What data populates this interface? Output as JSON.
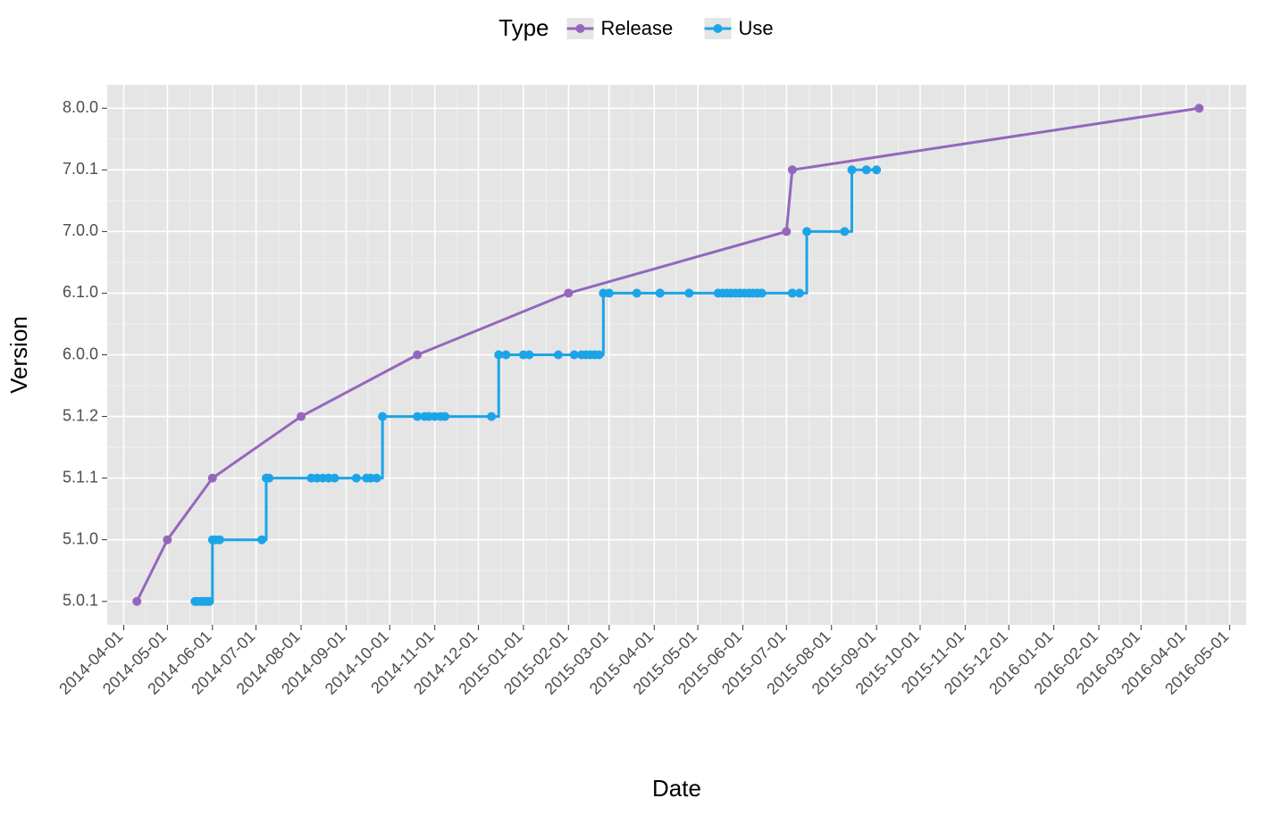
{
  "chart_data": {
    "type": "line",
    "title": "",
    "xlabel": "Date",
    "ylabel": "Version",
    "legend_title": "Type",
    "legend_position": "top",
    "colors": {
      "Release": "#9467BD",
      "Use": "#1CA4E8"
    },
    "y_categories": [
      "5.0.1",
      "5.1.0",
      "5.1.1",
      "5.1.2",
      "6.0.0",
      "6.1.0",
      "7.0.0",
      "7.0.1",
      "8.0.0"
    ],
    "x_ticks": [
      "2014-04-01",
      "2014-05-01",
      "2014-06-01",
      "2014-07-01",
      "2014-08-01",
      "2014-09-01",
      "2014-10-01",
      "2014-11-01",
      "2014-12-01",
      "2015-01-01",
      "2015-02-01",
      "2015-03-01",
      "2015-04-01",
      "2015-05-01",
      "2015-06-01",
      "2015-07-01",
      "2015-08-01",
      "2015-09-01",
      "2015-10-01",
      "2015-11-01",
      "2015-12-01",
      "2016-01-01",
      "2016-02-01",
      "2016-03-01",
      "2016-04-01",
      "2016-05-01"
    ],
    "series": [
      {
        "name": "Release",
        "mode": "line+markers",
        "points": [
          {
            "x": "2014-04-10",
            "y": "5.0.1"
          },
          {
            "x": "2014-05-01",
            "y": "5.1.0"
          },
          {
            "x": "2014-06-01",
            "y": "5.1.1"
          },
          {
            "x": "2014-08-01",
            "y": "5.1.2"
          },
          {
            "x": "2014-10-20",
            "y": "6.0.0"
          },
          {
            "x": "2015-02-01",
            "y": "6.1.0"
          },
          {
            "x": "2015-07-01",
            "y": "7.0.0"
          },
          {
            "x": "2015-07-05",
            "y": "7.0.1"
          },
          {
            "x": "2016-04-10",
            "y": "8.0.0"
          }
        ]
      },
      {
        "name": "Use",
        "mode": "step+markers",
        "points": [
          {
            "x": "2014-05-20",
            "y": "5.0.1"
          },
          {
            "x": "2014-05-22",
            "y": "5.0.1"
          },
          {
            "x": "2014-05-24",
            "y": "5.0.1"
          },
          {
            "x": "2014-05-26",
            "y": "5.0.1"
          },
          {
            "x": "2014-05-28",
            "y": "5.0.1"
          },
          {
            "x": "2014-05-30",
            "y": "5.0.1"
          },
          {
            "x": "2014-06-01",
            "y": "5.1.0"
          },
          {
            "x": "2014-06-03",
            "y": "5.1.0"
          },
          {
            "x": "2014-06-06",
            "y": "5.1.0"
          },
          {
            "x": "2014-07-05",
            "y": "5.1.0"
          },
          {
            "x": "2014-07-08",
            "y": "5.1.1"
          },
          {
            "x": "2014-07-10",
            "y": "5.1.1"
          },
          {
            "x": "2014-08-08",
            "y": "5.1.1"
          },
          {
            "x": "2014-08-12",
            "y": "5.1.1"
          },
          {
            "x": "2014-08-16",
            "y": "5.1.1"
          },
          {
            "x": "2014-08-20",
            "y": "5.1.1"
          },
          {
            "x": "2014-08-24",
            "y": "5.1.1"
          },
          {
            "x": "2014-09-08",
            "y": "5.1.1"
          },
          {
            "x": "2014-09-15",
            "y": "5.1.1"
          },
          {
            "x": "2014-09-18",
            "y": "5.1.1"
          },
          {
            "x": "2014-09-22",
            "y": "5.1.1"
          },
          {
            "x": "2014-09-26",
            "y": "5.1.2"
          },
          {
            "x": "2014-10-20",
            "y": "5.1.2"
          },
          {
            "x": "2014-10-25",
            "y": "5.1.2"
          },
          {
            "x": "2014-10-28",
            "y": "5.1.2"
          },
          {
            "x": "2014-11-01",
            "y": "5.1.2"
          },
          {
            "x": "2014-11-05",
            "y": "5.1.2"
          },
          {
            "x": "2014-11-08",
            "y": "5.1.2"
          },
          {
            "x": "2014-12-10",
            "y": "5.1.2"
          },
          {
            "x": "2014-12-15",
            "y": "6.0.0"
          },
          {
            "x": "2014-12-20",
            "y": "6.0.0"
          },
          {
            "x": "2015-01-01",
            "y": "6.0.0"
          },
          {
            "x": "2015-01-05",
            "y": "6.0.0"
          },
          {
            "x": "2015-01-25",
            "y": "6.0.0"
          },
          {
            "x": "2015-02-05",
            "y": "6.0.0"
          },
          {
            "x": "2015-02-10",
            "y": "6.0.0"
          },
          {
            "x": "2015-02-13",
            "y": "6.0.0"
          },
          {
            "x": "2015-02-16",
            "y": "6.0.0"
          },
          {
            "x": "2015-02-19",
            "y": "6.0.0"
          },
          {
            "x": "2015-02-22",
            "y": "6.0.0"
          },
          {
            "x": "2015-02-25",
            "y": "6.1.0"
          },
          {
            "x": "2015-03-01",
            "y": "6.1.0"
          },
          {
            "x": "2015-03-20",
            "y": "6.1.0"
          },
          {
            "x": "2015-04-05",
            "y": "6.1.0"
          },
          {
            "x": "2015-04-25",
            "y": "6.1.0"
          },
          {
            "x": "2015-05-15",
            "y": "6.1.0"
          },
          {
            "x": "2015-05-18",
            "y": "6.1.0"
          },
          {
            "x": "2015-05-21",
            "y": "6.1.0"
          },
          {
            "x": "2015-05-24",
            "y": "6.1.0"
          },
          {
            "x": "2015-05-27",
            "y": "6.1.0"
          },
          {
            "x": "2015-05-30",
            "y": "6.1.0"
          },
          {
            "x": "2015-06-02",
            "y": "6.1.0"
          },
          {
            "x": "2015-06-05",
            "y": "6.1.0"
          },
          {
            "x": "2015-06-08",
            "y": "6.1.0"
          },
          {
            "x": "2015-06-11",
            "y": "6.1.0"
          },
          {
            "x": "2015-06-14",
            "y": "6.1.0"
          },
          {
            "x": "2015-07-05",
            "y": "6.1.0"
          },
          {
            "x": "2015-07-10",
            "y": "6.1.0"
          },
          {
            "x": "2015-07-15",
            "y": "7.0.0"
          },
          {
            "x": "2015-08-10",
            "y": "7.0.0"
          },
          {
            "x": "2015-08-15",
            "y": "7.0.1"
          },
          {
            "x": "2015-08-25",
            "y": "7.0.1"
          },
          {
            "x": "2015-09-01",
            "y": "7.0.1"
          }
        ]
      }
    ]
  }
}
